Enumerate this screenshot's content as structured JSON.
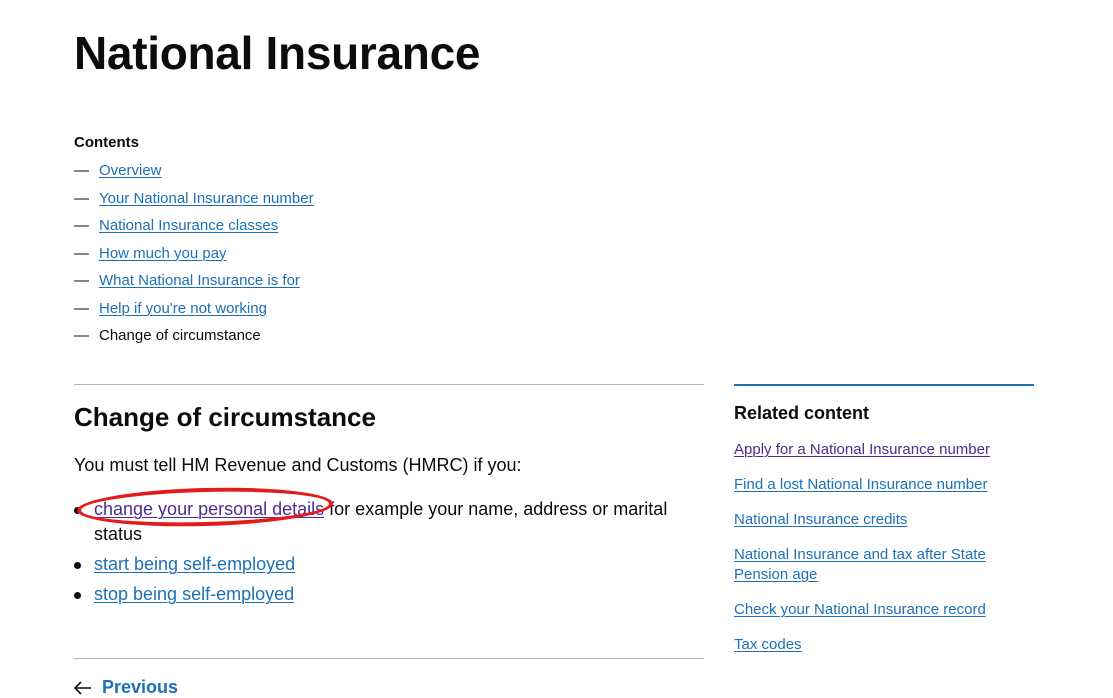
{
  "page": {
    "title": "National Insurance"
  },
  "contents": {
    "heading": "Contents",
    "dash": "—",
    "items": [
      {
        "label": "Overview"
      },
      {
        "label": "Your National Insurance number"
      },
      {
        "label": "National Insurance classes"
      },
      {
        "label": "How much you pay"
      },
      {
        "label": "What National Insurance is for"
      },
      {
        "label": "Help if you're not working"
      },
      {
        "label": "Change of circumstance"
      }
    ]
  },
  "main": {
    "section_title": "Change of circumstance",
    "intro": "You must tell HM Revenue and Customs (HMRC) if you:",
    "bullets": [
      {
        "link": "change your personal details",
        "after": " for example your name, address or marital status"
      },
      {
        "link": "start being self-employed",
        "after": ""
      },
      {
        "link": "stop being self-employed",
        "after": ""
      }
    ]
  },
  "pagination": {
    "previous_label": "Previous"
  },
  "related": {
    "title": "Related content",
    "links": [
      "Apply for a National Insurance number",
      "Find a lost National Insurance number",
      "National Insurance credits",
      "National Insurance and tax after State Pension age",
      "Check your National Insurance record",
      "Tax codes"
    ]
  },
  "colors": {
    "link": "#1d70b8",
    "visited_link": "#4c2c92",
    "text": "#0b0c0c",
    "annotation": "#e41b1b"
  }
}
